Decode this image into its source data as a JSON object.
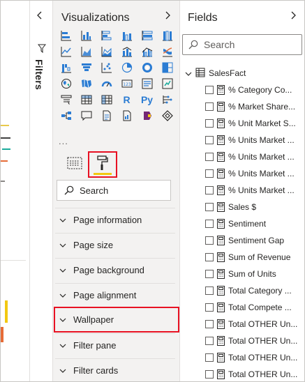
{
  "colors": {
    "accent": "#f2c811",
    "highlight": "#e81123",
    "pane_bg": "#f3f2f1"
  },
  "filters": {
    "label": "Filters",
    "collapse_icon": "chevron-left-icon"
  },
  "visualizations": {
    "title": "Visualizations",
    "expand_icon": "chevron-right-icon",
    "icons": [
      "stacked-bar-chart-icon",
      "stacked-column-chart-icon",
      "clustered-bar-chart-icon",
      "clustered-column-chart-icon",
      "100-stacked-bar-chart-icon",
      "100-stacked-column-chart-icon",
      "line-chart-icon",
      "area-chart-icon",
      "stacked-area-chart-icon",
      "line-and-column-chart-icon",
      "line-and-clustered-column-chart-icon",
      "ribbon-chart-icon",
      "waterfall-chart-icon",
      "funnel-icon",
      "scatter-chart-icon",
      "pie-chart-icon",
      "donut-chart-icon",
      "treemap-icon",
      "map-icon",
      "filled-map-icon",
      "gauge-icon",
      "card-icon",
      "multi-row-card-icon",
      "kpi-icon",
      "slicer-icon",
      "table-icon",
      "matrix-icon",
      "r-visual-icon",
      "python-visual-icon",
      "key-influencers-icon",
      "decomposition-tree-icon",
      "qa-icon",
      "smart-narrative-icon",
      "paginated-report-icon",
      "power-apps-icon",
      "power-automate-icon"
    ],
    "r_glyph": "R",
    "py_glyph": "Py",
    "more": "...",
    "search": {
      "placeholder": "Search"
    },
    "sections": [
      "Page information",
      "Page size",
      "Page background",
      "Page alignment",
      "Wallpaper",
      "Filter pane",
      "Filter cards"
    ],
    "selected_section": "Wallpaper"
  },
  "fields": {
    "title": "Fields",
    "expand_icon": "chevron-right-icon",
    "search": {
      "placeholder": "Search"
    },
    "table": {
      "name": "SalesFact",
      "expanded": true
    },
    "items": [
      "% Category Co...",
      "% Market Share...",
      "% Unit Market S...",
      "% Units Market ...",
      "% Units Market ...",
      "% Units Market ...",
      "% Units Market ...",
      "Sales $",
      "Sentiment",
      "Sentiment Gap",
      "Sum of Revenue",
      "Sum of Units",
      "Total Category ...",
      "Total Compete ...",
      "Total OTHER Un...",
      "Total OTHER Un...",
      "Total OTHER Un...",
      "Total OTHER Un..."
    ]
  }
}
